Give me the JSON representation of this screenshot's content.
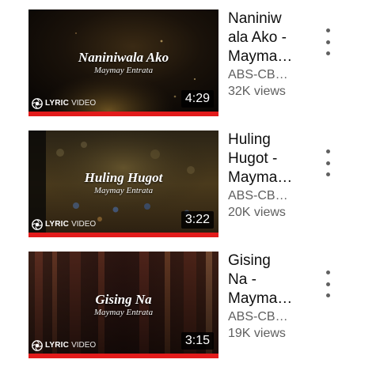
{
  "videos": [
    {
      "title_line1": "Naniniw",
      "title_line2": "ala Ako -",
      "title_line3": "Mayma…",
      "channel": "ABS-CB…",
      "views": "32K views",
      "duration": "4:29",
      "thumb_title": "Naniniwala Ako",
      "thumb_artist": "Maymay Entrata",
      "badge_strong": "LYRIC",
      "badge_light": "VIDEO"
    },
    {
      "title_line1": "Huling",
      "title_line2": "Hugot -",
      "title_line3": "Mayma…",
      "channel": "ABS-CB…",
      "views": "20K views",
      "duration": "3:22",
      "thumb_title": "Huling Hugot",
      "thumb_artist": "Maymay Entrata",
      "badge_strong": "LYRIC",
      "badge_light": "VIDEO"
    },
    {
      "title_line1": "Gising",
      "title_line2": "Na -",
      "title_line3": "Mayma…",
      "channel": "ABS-CB…",
      "views": "19K views",
      "duration": "3:15",
      "thumb_title": "Gising Na",
      "thumb_artist": "Maymay Entrata",
      "badge_strong": "LYRIC",
      "badge_light": "VIDEO"
    }
  ],
  "colors": {
    "progress_red": "#e21b1b",
    "title_text": "#0f0f0f",
    "secondary_text": "#606060"
  },
  "icons": {
    "more": "more-vert-icon",
    "badge": "camera-aperture-icon"
  }
}
